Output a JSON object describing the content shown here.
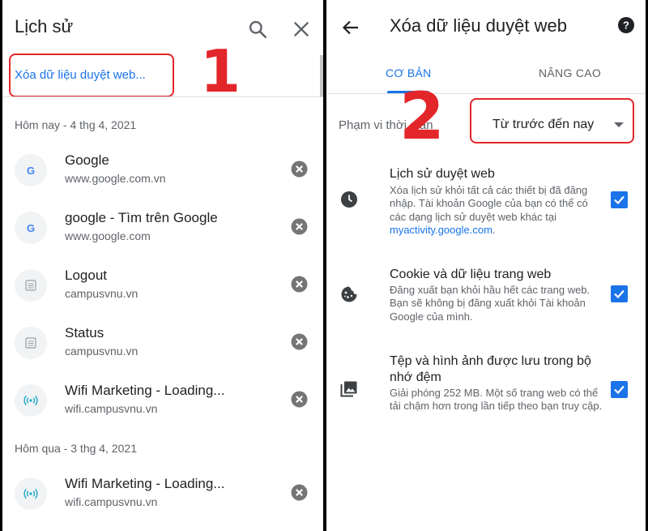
{
  "left_panel": {
    "title": "Lịch sử",
    "clear_link": "Xóa dữ liệu duyệt web...",
    "sections": [
      {
        "label": "Hôm nay - 4 thg 4, 2021",
        "items": [
          {
            "title": "Google",
            "url": "www.google.com.vn",
            "favicon": "google-g-icon"
          },
          {
            "title": "google - Tìm trên Google",
            "url": "www.google.com",
            "favicon": "google-g-icon"
          },
          {
            "title": "Logout",
            "url": "campusvnu.vn",
            "favicon": "document-icon"
          },
          {
            "title": "Status",
            "url": "campusvnu.vn",
            "favicon": "document-icon"
          },
          {
            "title": "Wifi Marketing - Loading...",
            "url": "wifi.campusvnu.vn",
            "favicon": "wifi-icon"
          }
        ]
      },
      {
        "label": "Hôm qua - 3 thg 4, 2021",
        "items": [
          {
            "title": "Wifi Marketing - Loading...",
            "url": "wifi.campusvnu.vn",
            "favicon": "wifi-icon"
          }
        ]
      }
    ],
    "annotation_number": "1"
  },
  "right_panel": {
    "title": "Xóa dữ liệu duyệt web",
    "tabs": [
      {
        "label": "CƠ BẢN",
        "active": true
      },
      {
        "label": "NÂNG CAO",
        "active": false
      }
    ],
    "time_range": {
      "label": "Phạm vi thời gian",
      "value": "Từ trước đến nay"
    },
    "options": [
      {
        "title": "Lịch sử duyệt web",
        "description": "Xóa lịch sử khỏi tất cả các thiết bị đã đăng nhập. Tài khoản Google của bạn có thể có các dạng lịch sử duyệt web khác tại ",
        "link": "myactivity.google.com",
        "link_suffix": ".",
        "icon": "clock-icon",
        "checked": true
      },
      {
        "title": "Cookie và dữ liệu trang web",
        "description": "Đăng xuất bạn khỏi hầu hết các trang web. Bạn sẽ không bị đăng xuất khỏi Tài khoản Google của mình.",
        "icon": "cookie-icon",
        "checked": true
      },
      {
        "title": "Tệp và hình ảnh được lưu trong bộ nhớ đệm",
        "description": "Giải phóng 252 MB. Một số trang web có thể tải chậm hơn trong lần tiếp theo bạn truy cập.",
        "icon": "image-icon",
        "checked": true
      }
    ],
    "annotation_number": "2"
  },
  "colors": {
    "accent": "#1a73e8",
    "annotation": "#e3262a",
    "text_primary": "#202124",
    "text_secondary": "#5f6368"
  }
}
